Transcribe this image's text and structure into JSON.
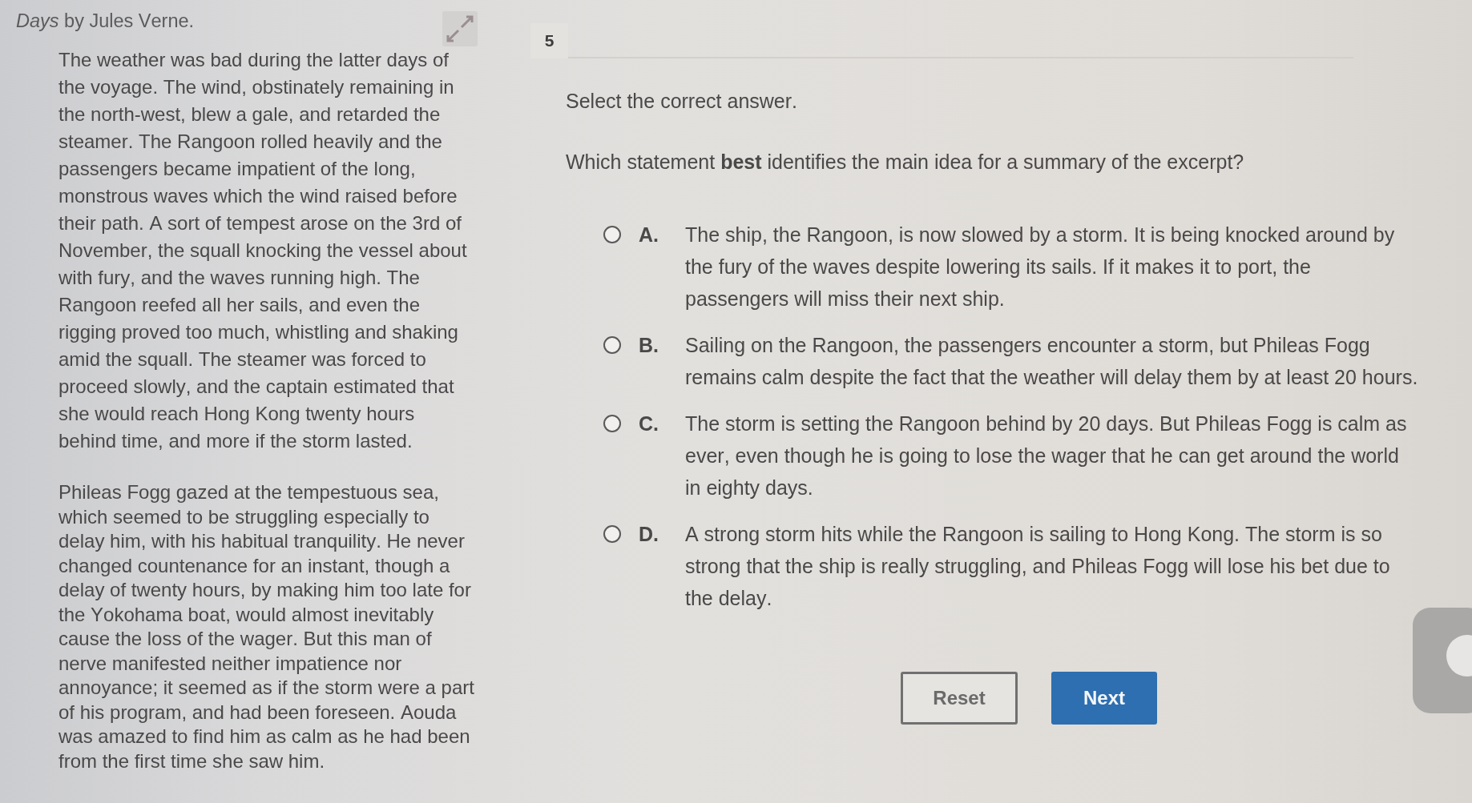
{
  "passage": {
    "source": "*Days* by Jules Verne.",
    "paragraphs": [
      "The weather was bad during the latter days of the voyage. The wind, obstinately remaining in the north-west, blew a gale, and retarded the steamer. The Rangoon rolled heavily and the passengers became impatient of the long, monstrous waves which the wind raised before their path. A sort of tempest arose on the 3rd of November, the squall knocking the vessel about with fury, and the waves running high. The Rangoon reefed all her sails, and even the rigging proved too much, whistling and shaking amid the squall. The steamer was forced to proceed slowly, and the captain estimated that she would reach Hong Kong twenty hours behind time, and more if the storm lasted.",
      "Phileas Fogg gazed at the tempestuous sea, which seemed to be struggling especially to delay him, with his habitual tranquility. He never changed countenance for an instant, though a delay of twenty hours, by making him too late for the Yokohama boat, would almost inevitably cause the loss of the wager. But this man of nerve manifested neither impatience nor annoyance; it seemed as if the storm were a part of his program, and had been foreseen. Aouda was amazed to find him as calm as he had been from the first time she saw him."
    ]
  },
  "question": {
    "number": "5",
    "instruction": "Select the correct answer.",
    "prompt": "Which statement **best** identifies the main idea for a summary of the excerpt?",
    "options": [
      {
        "letter": "A.",
        "text": "The ship, the Rangoon, is now slowed by a storm. It is being knocked around by the fury of the waves despite lowering its sails. If it makes it to port, the passengers will miss their next ship.",
        "selected": false
      },
      {
        "letter": "B.",
        "text": "Sailing on the Rangoon, the passengers encounter a storm, but Phileas Fogg remains calm despite the fact that the weather will delay them by at least 20 hours.",
        "selected": false
      },
      {
        "letter": "C.",
        "text": "The storm is setting the Rangoon behind by 20 days. But Phileas Fogg is calm as ever, even though he is going to lose the wager that he can get around the world in eighty days.",
        "selected": false
      },
      {
        "letter": "D.",
        "text": "A strong storm hits while the Rangoon is sailing to Hong Kong. The storm is so strong that the ship is really struggling, and Phileas Fogg will lose his bet due to the delay.",
        "selected": false
      }
    ]
  },
  "buttons": [
    {
      "label": "Reset",
      "kind": "secondary"
    },
    {
      "label": "Next",
      "kind": "primary"
    }
  ]
}
